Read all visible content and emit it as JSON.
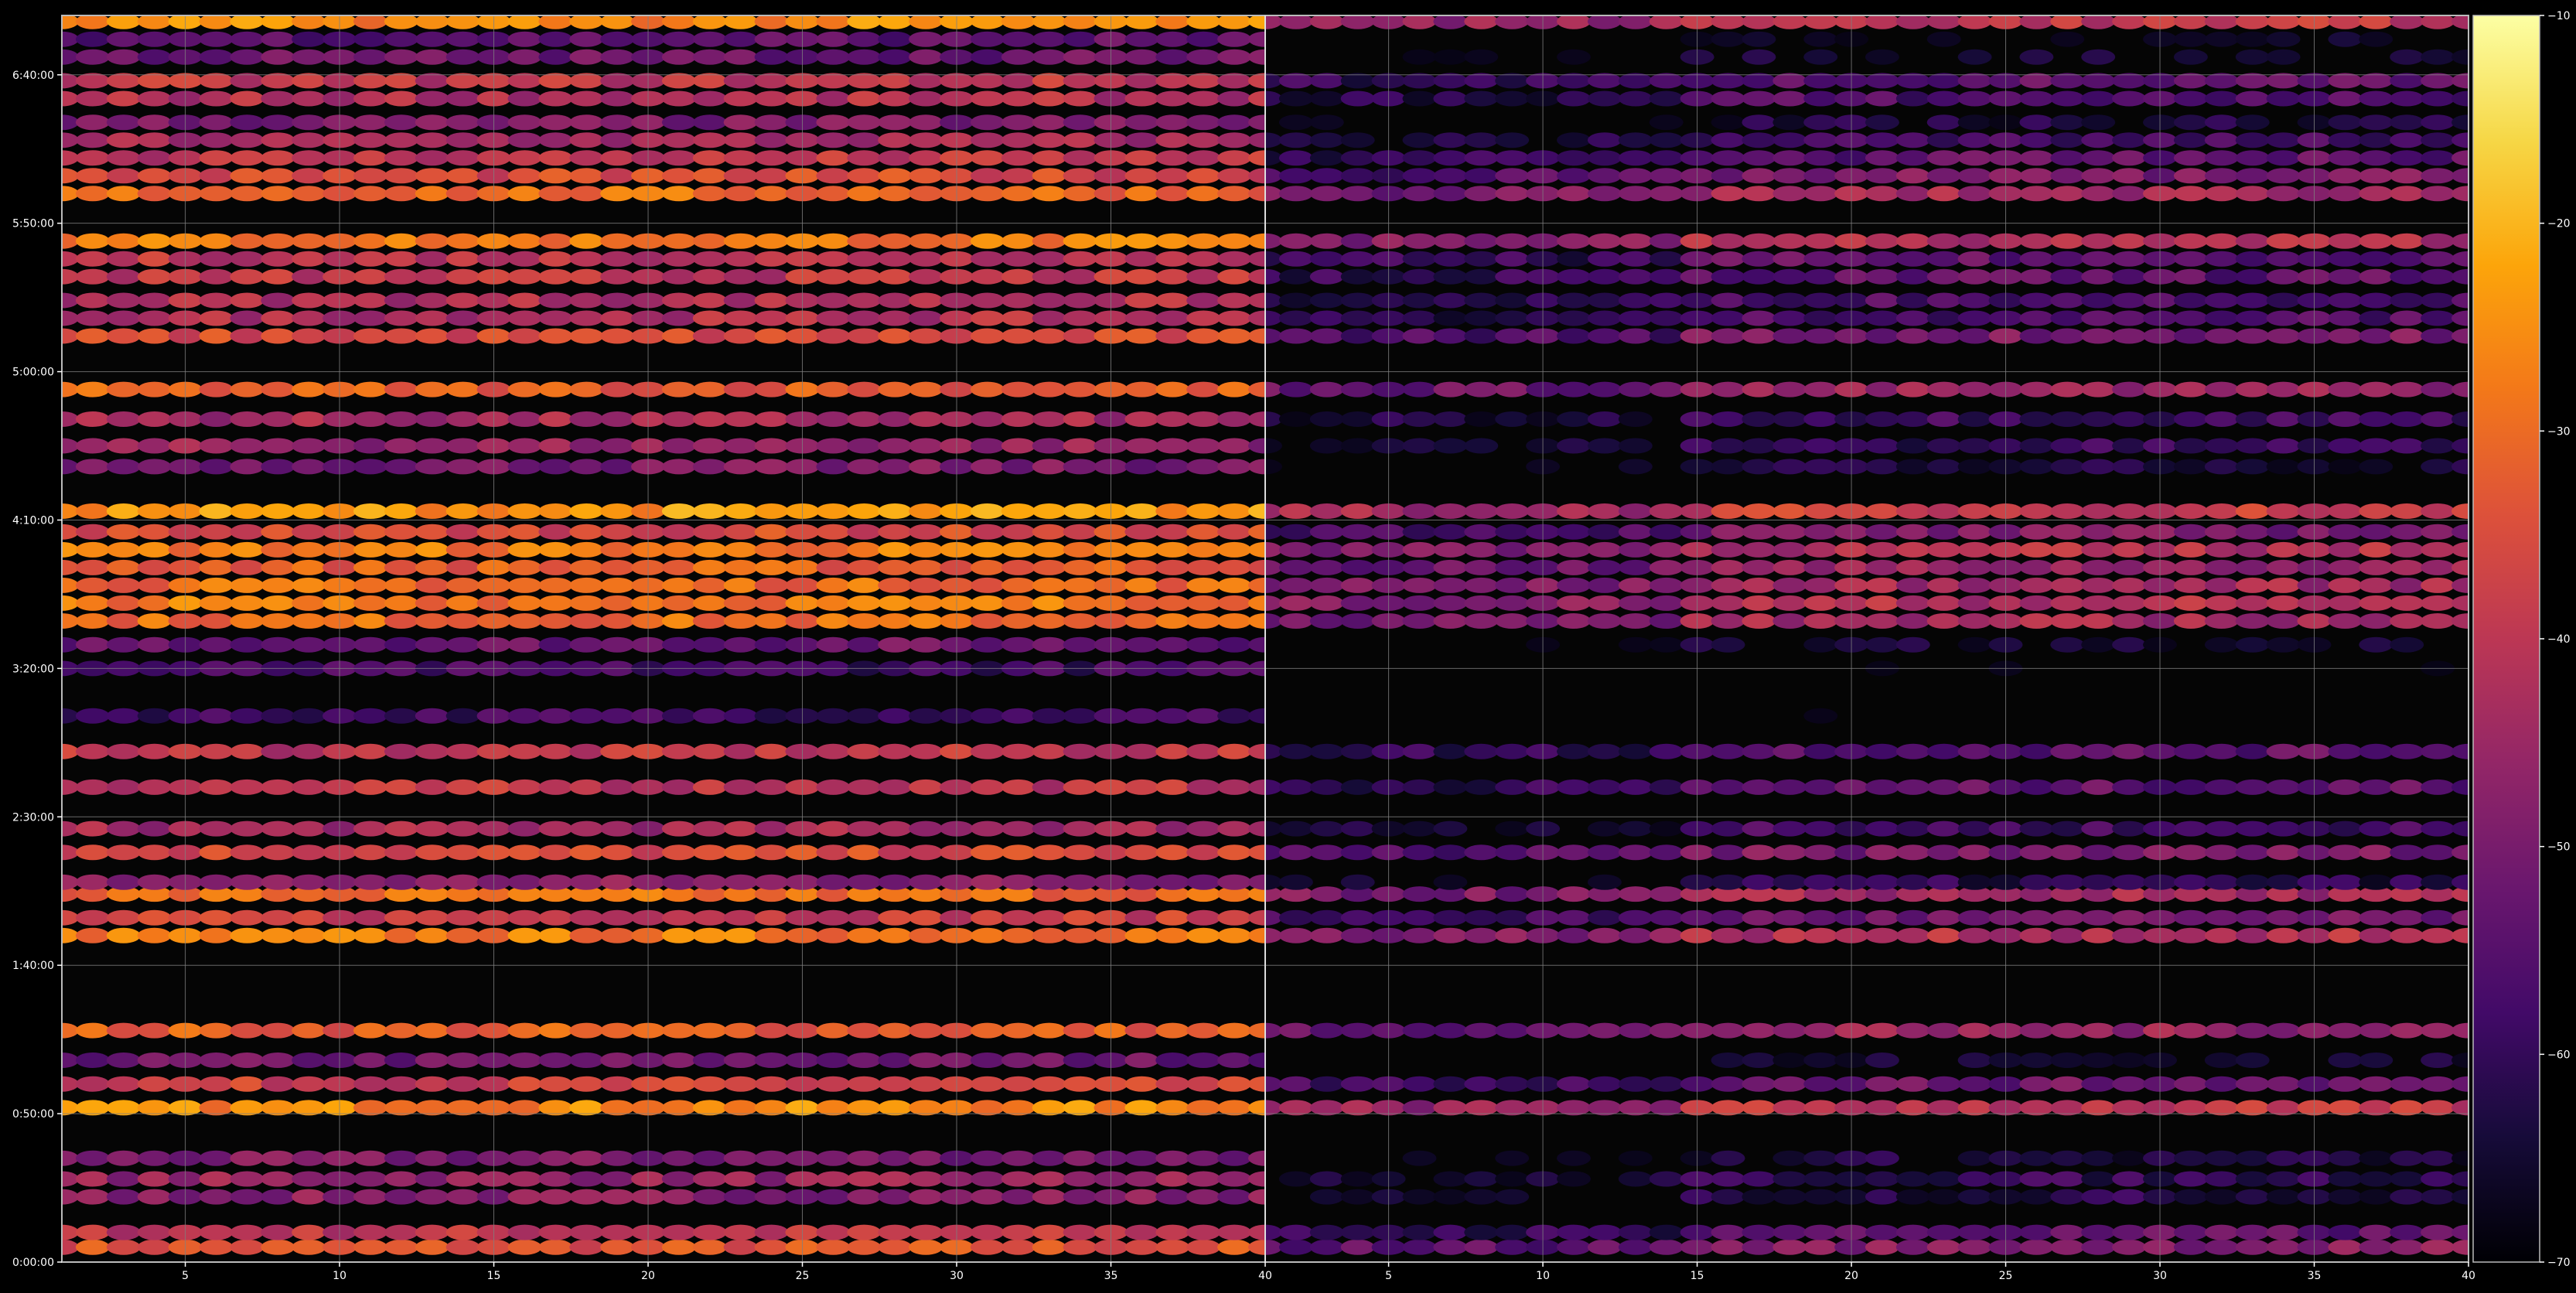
{
  "chart_data": {
    "type": "heatmap",
    "panels": 2,
    "x_range": [
      1,
      40
    ],
    "x_ticks": [
      5,
      10,
      15,
      20,
      25,
      30,
      35,
      40
    ],
    "x_tick_labels": [
      "5",
      "10",
      "15",
      "20",
      "25",
      "30",
      "35",
      "40"
    ],
    "y_range_minutes": [
      0,
      420
    ],
    "y_ticks_minutes": [
      0,
      50,
      100,
      150,
      200,
      250,
      300,
      350,
      400
    ],
    "y_tick_labels": [
      "0:00:00",
      "0:50:00",
      "1:40:00",
      "2:30:00",
      "3:20:00",
      "4:10:00",
      "5:00:00",
      "5:50:00",
      "6:40:00"
    ],
    "grid": true,
    "colormap": "inferno",
    "colorbar": {
      "range": [
        -70,
        -10
      ],
      "ticks": [
        -70,
        -60,
        -50,
        -40,
        -30,
        -20,
        -10
      ],
      "tick_labels": [
        "−70",
        "−60",
        "−50",
        "−40",
        "−30",
        "−20",
        "−10"
      ]
    },
    "panel_offsets_db": [
      0,
      -14
    ],
    "rows": [
      {
        "t": 5,
        "level": -34
      },
      {
        "t": 10,
        "level": -40
      },
      {
        "t": 22,
        "level": -48
      },
      {
        "t": 28,
        "level": -46
      },
      {
        "t": 35,
        "level": -50
      },
      {
        "t": 52,
        "level": -26
      },
      {
        "t": 60,
        "level": -38
      },
      {
        "t": 68,
        "level": -52
      },
      {
        "t": 78,
        "level": -32
      },
      {
        "t": 110,
        "level": -28
      },
      {
        "t": 116,
        "level": -38
      },
      {
        "t": 124,
        "level": -30
      },
      {
        "t": 128,
        "level": -48
      },
      {
        "t": 138,
        "level": -36
      },
      {
        "t": 146,
        "level": -44
      },
      {
        "t": 160,
        "level": -40
      },
      {
        "t": 172,
        "level": -40
      },
      {
        "t": 184,
        "level": -58
      },
      {
        "t": 200,
        "level": -58
      },
      {
        "t": 208,
        "level": -52
      },
      {
        "t": 216,
        "level": -30
      },
      {
        "t": 222,
        "level": -28
      },
      {
        "t": 228,
        "level": -30
      },
      {
        "t": 234,
        "level": -32
      },
      {
        "t": 240,
        "level": -28
      },
      {
        "t": 246,
        "level": -36
      },
      {
        "t": 253,
        "level": -24
      },
      {
        "t": 268,
        "level": -50
      },
      {
        "t": 275,
        "level": -46
      },
      {
        "t": 284,
        "level": -44
      },
      {
        "t": 294,
        "level": -32
      },
      {
        "t": 312,
        "level": -36
      },
      {
        "t": 318,
        "level": -42
      },
      {
        "t": 324,
        "level": -42
      },
      {
        "t": 332,
        "level": -40
      },
      {
        "t": 338,
        "level": -40
      },
      {
        "t": 344,
        "level": -28
      },
      {
        "t": 360,
        "level": -30
      },
      {
        "t": 366,
        "level": -36
      },
      {
        "t": 372,
        "level": -40
      },
      {
        "t": 378,
        "level": -44
      },
      {
        "t": 384,
        "level": -50
      },
      {
        "t": 392,
        "level": -42
      },
      {
        "t": 398,
        "level": -40
      },
      {
        "t": 406,
        "level": -52
      },
      {
        "t": 412,
        "level": -54
      },
      {
        "t": 418,
        "level": -26
      }
    ]
  }
}
